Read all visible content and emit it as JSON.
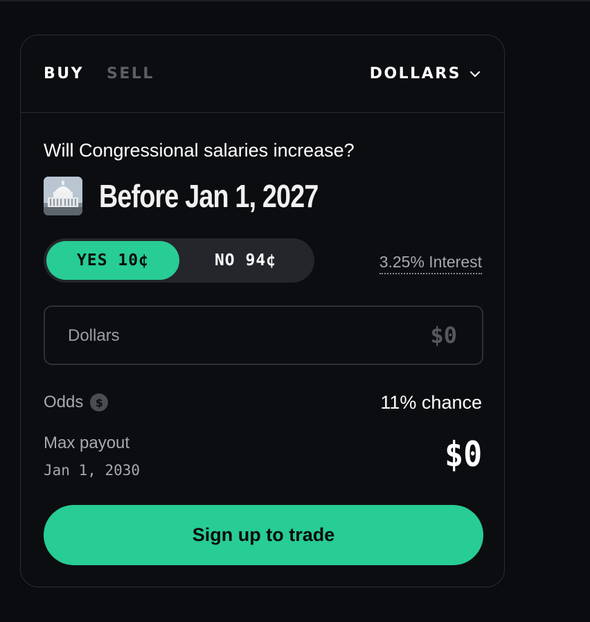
{
  "header": {
    "tabs": [
      {
        "label": "BUY",
        "active": true
      },
      {
        "label": "SELL",
        "active": false
      }
    ],
    "currency_label": "DOLLARS"
  },
  "market": {
    "question": "Will Congressional salaries increase?",
    "title": "Before Jan 1, 2027",
    "thumbnail_icon": "capitol-building-image"
  },
  "outcomes": {
    "yes_label": "YES 10¢",
    "no_label": "NO 94¢",
    "selected": "yes"
  },
  "interest_label": "3.25% Interest",
  "amount": {
    "label": "Dollars",
    "value": "$0"
  },
  "odds": {
    "label": "Odds",
    "value": "11% chance"
  },
  "payout": {
    "label": "Max payout",
    "date": "Jan 1, 2030",
    "value": "$0"
  },
  "cta_label": "Sign up to trade",
  "colors": {
    "accent": "#28cc95",
    "background": "#0b0c0f",
    "card_border": "#2a2c31",
    "muted_text": "#a7a9ae"
  }
}
